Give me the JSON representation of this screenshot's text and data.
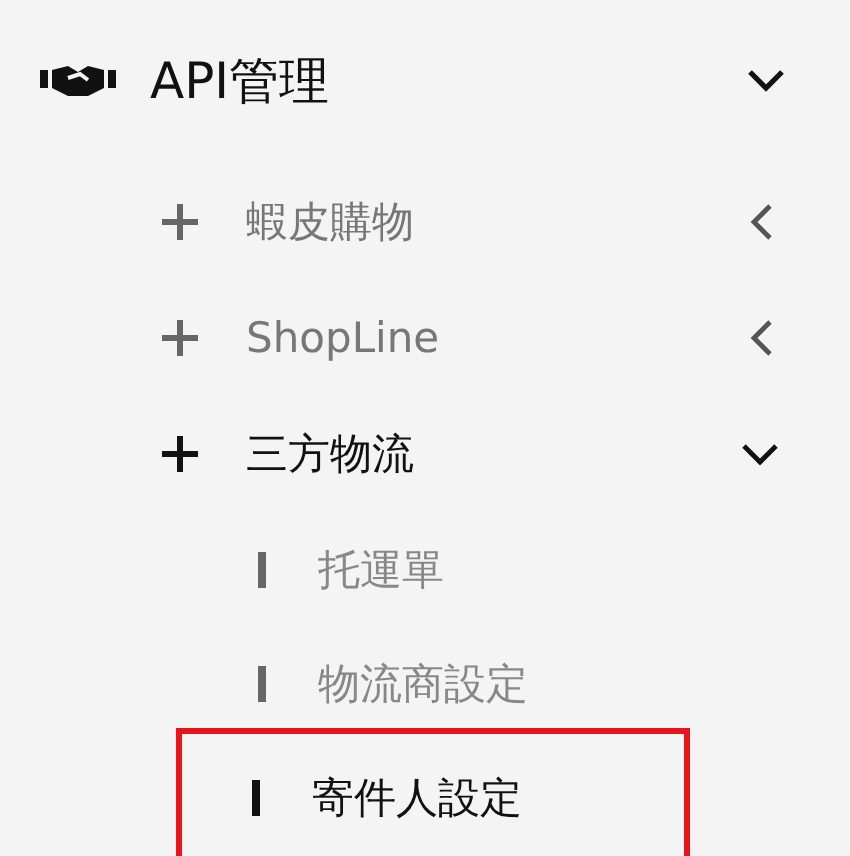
{
  "menu": {
    "label": "API管理",
    "expanded": true,
    "children": [
      {
        "label": "蝦皮購物",
        "expanded": false
      },
      {
        "label": "ShopLine",
        "expanded": false
      },
      {
        "label": "三方物流",
        "expanded": true,
        "children": [
          {
            "label": "托運單",
            "selected": false
          },
          {
            "label": "物流商設定",
            "selected": false
          },
          {
            "label": "寄件人設定",
            "selected": true
          }
        ]
      }
    ]
  }
}
